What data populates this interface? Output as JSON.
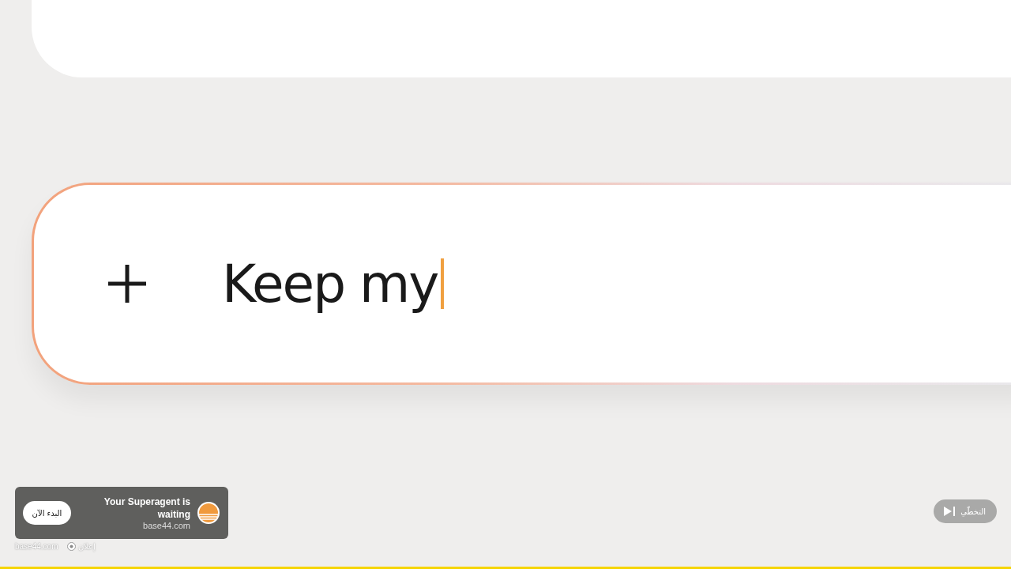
{
  "prompt": {
    "value": "Keep my"
  },
  "ad": {
    "title": "Your Superagent is waiting",
    "domain": "base44.com",
    "cta": "البدء الآن",
    "footer_domain": "base44.com",
    "ad_label": "إعلان"
  },
  "skip": {
    "label": "التخطّي"
  },
  "progress": {
    "level": 1
  }
}
